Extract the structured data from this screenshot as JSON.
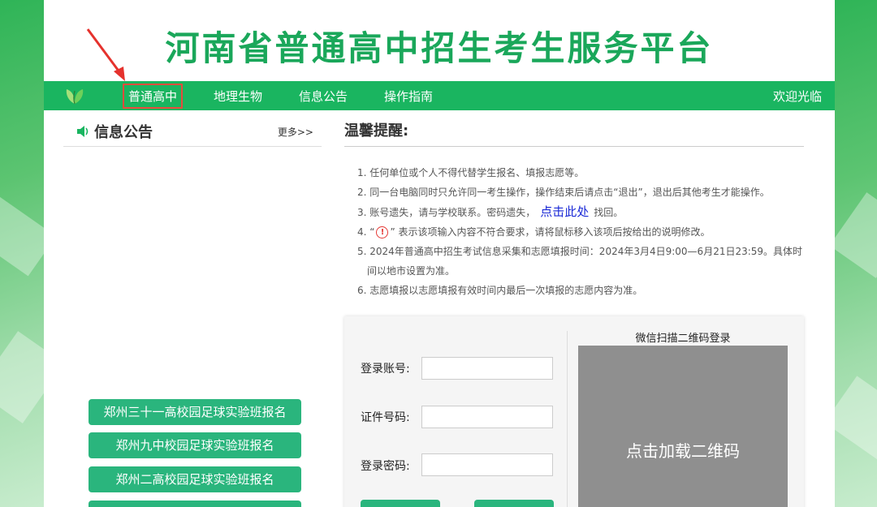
{
  "site": {
    "title": "河南省普通高中招生考生服务平台"
  },
  "nav": {
    "items": [
      {
        "label": "普通高中",
        "active": true
      },
      {
        "label": "地理生物"
      },
      {
        "label": "信息公告"
      },
      {
        "label": "操作指南"
      }
    ],
    "welcome": "欢迎光临"
  },
  "notice_panel": {
    "title": "信息公告",
    "more": "更多>>",
    "buttons": [
      "郑州三十一高校园足球实验班报名",
      "郑州九中校园足球实验班报名",
      "郑州二高校园足球实验班报名"
    ]
  },
  "tips": {
    "title": "温馨提醒:",
    "items": {
      "t1": "1. 任何单位或个人不得代替学生报名、填报志愿等。",
      "t2": "2. 同一台电脑同时只允许同一考生操作，操作结束后请点击“退出”，退出后其他考生才能操作。",
      "t3_pre": "3. 账号遗失，请与学校联系。密码遗失，",
      "t3_link": "点击此处",
      "t3_post": "找回。",
      "t4_pre": "4. “",
      "t4_icon": "!",
      "t4_post": "” 表示该项输入内容不符合要求，请将鼠标移入该项后按给出的说明修改。",
      "t5a": "5. 2024年普通高中招生考试信息采集和志愿填报时间：2024年3月4日9:00—6月21日23:59。具体时",
      "t5b": "间以地市设置为准。",
      "t6": "6. 志愿填报以志愿填报有效时间内最后一次填报的志愿内容为准。"
    }
  },
  "login": {
    "account_label": "登录账号:",
    "id_label": "证件号码:",
    "password_label": "登录密码:",
    "account_value": "",
    "id_value": "",
    "password_value": "",
    "qr_caption": "微信扫描二维码登录",
    "qr_text": "点击加载二维码"
  },
  "colors": {
    "brand": "#1ab560",
    "title": "#1aa75a",
    "button": "#2ab57d",
    "highlight": "#e74c3c",
    "link": "#1a29d6"
  },
  "icons": [
    "leaf-logo-icon",
    "speaker-icon",
    "warning-icon",
    "red-arrow-annotation"
  ]
}
